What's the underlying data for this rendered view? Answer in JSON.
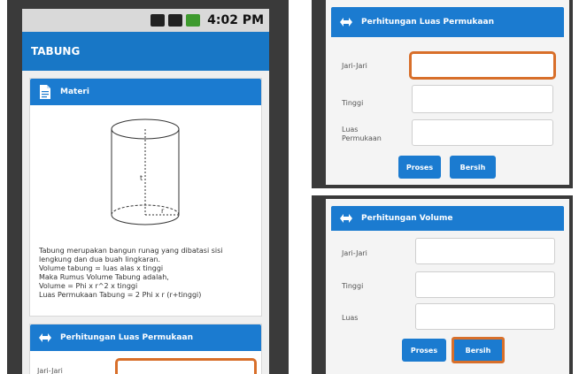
{
  "status_bar": {
    "time": "4:02 PM"
  },
  "app": {
    "title": "TABUNG"
  },
  "materi": {
    "title": "Materi",
    "diagram": {
      "height_label": "t",
      "radius_label": "r"
    },
    "text_lines": [
      "Tabung merupakan bangun runag yang dibatasi sisi",
      "lengkung dan dua buah lingkaran.",
      "Volume tabung = luas alas x tinggi",
      "Maka Rumus Volume Tabung adalah,",
      "Volume = Phi x r^2 x tinggi",
      "Luas Permukaan Tabung = 2 Phi x r (r+tinggi)"
    ]
  },
  "luas_card_left": {
    "title": "Perhitungan Luas Permukaan",
    "jari_label": "Jari-Jari"
  },
  "luas_card": {
    "title": "Perhitungan Luas Permukaan",
    "jari_label": "Jari-Jari",
    "tinggi_label": "Tinggi",
    "luas_label_1": "Luas",
    "luas_label_2": "Permukaan",
    "proses_label": "Proses",
    "bersih_label": "Bersih"
  },
  "volume_card": {
    "title": "Perhitungan Volume",
    "jari_label": "Jari-Jari",
    "tinggi_label": "Tinggi",
    "luas_label": "Luas",
    "proses_label": "Proses",
    "bersih_label": "Bersih"
  },
  "colors": {
    "accent": "#1b7bd0",
    "focus": "#d86f2a"
  }
}
